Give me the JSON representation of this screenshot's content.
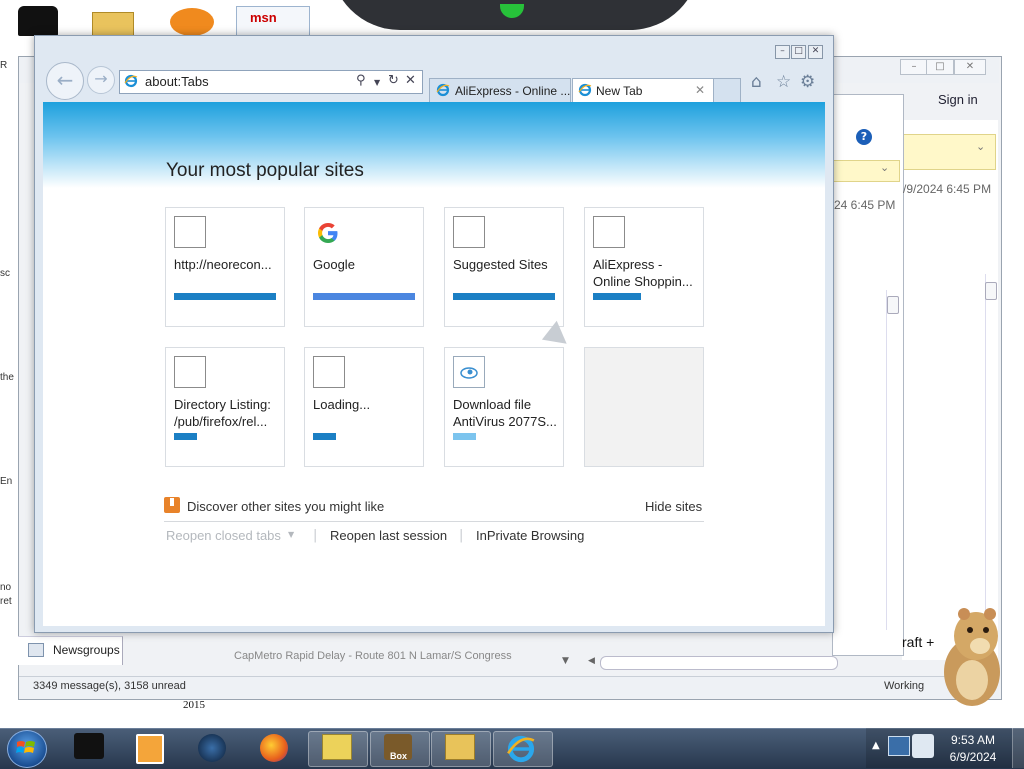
{
  "browser": {
    "address": "about:Tabs",
    "tabs": [
      {
        "label": "AliExpress - Online ..."
      },
      {
        "label": "New Tab"
      }
    ]
  },
  "newtab": {
    "heading": "Your most popular sites",
    "tiles": [
      {
        "title": "http://neorecon...",
        "bar_color": "#1b7fc4",
        "bar_fraction": 1.0
      },
      {
        "title": "Google",
        "bar_color": "#4b86e0",
        "bar_fraction": 1.0
      },
      {
        "title": "Suggested Sites",
        "bar_color": "#1b7fc4",
        "bar_fraction": 1.0
      },
      {
        "title": "AliExpress -\nOnline Shoppin...",
        "bar_color": "#1b7fc4",
        "bar_fraction": 0.47
      },
      {
        "title": "Directory Listing:\n/pub/firefox/rel...",
        "bar_color": "#1b7fc4",
        "bar_fraction": 0.23
      },
      {
        "title": "Loading...",
        "bar_color": "#1b7fc4",
        "bar_fraction": 0.23
      },
      {
        "title": "Download file\nAntiVirus 2077S...",
        "bar_color": "#7cc4ee",
        "bar_fraction": 0.23
      }
    ],
    "discover": "Discover other sites you might like",
    "hide_sites": "Hide sites",
    "reopen_closed": "Reopen closed tabs",
    "reopen_last": "Reopen last session",
    "inprivate": "InPrivate Browsing"
  },
  "mail": {
    "sign_in": "Sign in",
    "timestamp_1": "/9/2024 6:45 PM",
    "timestamp_2": "24 6:45 PM",
    "folder": "Newsgroups",
    "subject": "CapMetro Rapid Delay - Route 801 N Lamar/S Congress",
    "status": "3349 message(s), 3158 unread",
    "working": "Working",
    "craft": "raft +"
  },
  "desktop": {
    "msn_label": "msn",
    "year_label": "2015",
    "left_clip": [
      "R",
      "sc",
      "the",
      "En",
      "no",
      "ret"
    ]
  },
  "taskbar": {
    "time": "9:53 AM",
    "date": "6/9/2024",
    "box_label": "Box"
  }
}
